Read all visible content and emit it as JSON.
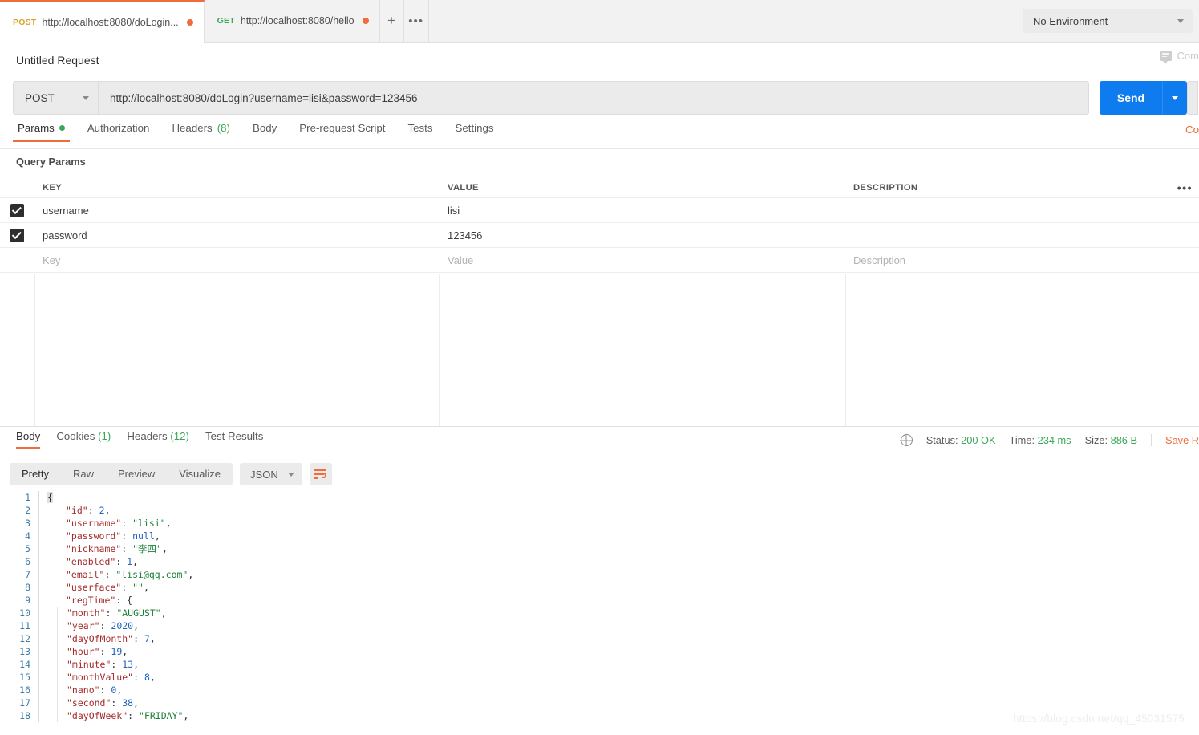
{
  "tabbar": {
    "tabs": [
      {
        "method": "POST",
        "url": "http://localhost:8080/doLogin...",
        "unsaved": true,
        "active": true
      },
      {
        "method": "GET",
        "url": "http://localhost:8080/hello",
        "unsaved": true,
        "active": false
      }
    ],
    "new_tab_label": "+",
    "more_label": "•••",
    "environment": {
      "value": "No Environment"
    }
  },
  "header": {
    "request_title": "Untitled Request",
    "comments_label": "Com"
  },
  "urlbar": {
    "method": "POST",
    "url": "http://localhost:8080/doLogin?username=lisi&password=123456",
    "send_label": "Send"
  },
  "request_tabs": {
    "items": [
      {
        "label": "Params",
        "dot": true,
        "count": "",
        "active": true
      },
      {
        "label": "Authorization",
        "dot": false,
        "count": "",
        "active": false
      },
      {
        "label": "Headers",
        "dot": false,
        "count": "(8)",
        "active": false
      },
      {
        "label": "Body",
        "dot": false,
        "count": "",
        "active": false
      },
      {
        "label": "Pre-request Script",
        "dot": false,
        "count": "",
        "active": false
      },
      {
        "label": "Tests",
        "dot": false,
        "count": "",
        "active": false
      },
      {
        "label": "Settings",
        "dot": false,
        "count": "",
        "active": false
      }
    ],
    "cookies_link": "Co"
  },
  "query_params": {
    "section_label": "Query Params",
    "columns": {
      "key": "KEY",
      "value": "VALUE",
      "description": "DESCRIPTION"
    },
    "rows": [
      {
        "checked": true,
        "key": "username",
        "value": "lisi",
        "description": "",
        "placeholder": false
      },
      {
        "checked": true,
        "key": "password",
        "value": "123456",
        "description": "",
        "placeholder": false
      }
    ],
    "placeholder_row": {
      "key": "Key",
      "value": "Value",
      "description": "Description"
    },
    "bulk_edit_label": "•••"
  },
  "response": {
    "tabs": [
      {
        "label": "Body",
        "count": "",
        "active": true
      },
      {
        "label": "Cookies",
        "count": "(1)",
        "active": false
      },
      {
        "label": "Headers",
        "count": "(12)",
        "active": false
      },
      {
        "label": "Test Results",
        "count": "",
        "active": false
      }
    ],
    "meta": {
      "status_label": "Status:",
      "status_value": "200 OK",
      "time_label": "Time:",
      "time_value": "234 ms",
      "size_label": "Size:",
      "size_value": "886 B",
      "save_response": "Save R"
    },
    "toolbar": {
      "views": [
        {
          "label": "Pretty",
          "active": true
        },
        {
          "label": "Raw",
          "active": false
        },
        {
          "label": "Preview",
          "active": false
        },
        {
          "label": "Visualize",
          "active": false
        }
      ],
      "format": "JSON"
    },
    "body_lines": [
      {
        "n": "1",
        "indent": 0,
        "tokens": [
          {
            "t": "p",
            "v": "{"
          }
        ]
      },
      {
        "n": "2",
        "indent": 1,
        "tokens": [
          {
            "t": "k",
            "v": "\"id\""
          },
          {
            "t": "p",
            "v": ": "
          },
          {
            "t": "n",
            "v": "2"
          },
          {
            "t": "p",
            "v": ","
          }
        ]
      },
      {
        "n": "3",
        "indent": 1,
        "tokens": [
          {
            "t": "k",
            "v": "\"username\""
          },
          {
            "t": "p",
            "v": ": "
          },
          {
            "t": "s",
            "v": "\"lisi\""
          },
          {
            "t": "p",
            "v": ","
          }
        ]
      },
      {
        "n": "4",
        "indent": 1,
        "tokens": [
          {
            "t": "k",
            "v": "\"password\""
          },
          {
            "t": "p",
            "v": ": "
          },
          {
            "t": "n",
            "v": "null"
          },
          {
            "t": "p",
            "v": ","
          }
        ]
      },
      {
        "n": "5",
        "indent": 1,
        "tokens": [
          {
            "t": "k",
            "v": "\"nickname\""
          },
          {
            "t": "p",
            "v": ": "
          },
          {
            "t": "s",
            "v": "\"李四\""
          },
          {
            "t": "p",
            "v": ","
          }
        ]
      },
      {
        "n": "6",
        "indent": 1,
        "tokens": [
          {
            "t": "k",
            "v": "\"enabled\""
          },
          {
            "t": "p",
            "v": ": "
          },
          {
            "t": "n",
            "v": "1"
          },
          {
            "t": "p",
            "v": ","
          }
        ]
      },
      {
        "n": "7",
        "indent": 1,
        "tokens": [
          {
            "t": "k",
            "v": "\"email\""
          },
          {
            "t": "p",
            "v": ": "
          },
          {
            "t": "s",
            "v": "\"lisi@qq.com\""
          },
          {
            "t": "p",
            "v": ","
          }
        ]
      },
      {
        "n": "8",
        "indent": 1,
        "tokens": [
          {
            "t": "k",
            "v": "\"userface\""
          },
          {
            "t": "p",
            "v": ": "
          },
          {
            "t": "s",
            "v": "\"\""
          },
          {
            "t": "p",
            "v": ","
          }
        ]
      },
      {
        "n": "9",
        "indent": 1,
        "tokens": [
          {
            "t": "k",
            "v": "\"regTime\""
          },
          {
            "t": "p",
            "v": ": {"
          }
        ]
      },
      {
        "n": "10",
        "indent": 2,
        "tokens": [
          {
            "t": "k",
            "v": "\"month\""
          },
          {
            "t": "p",
            "v": ": "
          },
          {
            "t": "s",
            "v": "\"AUGUST\""
          },
          {
            "t": "p",
            "v": ","
          }
        ]
      },
      {
        "n": "11",
        "indent": 2,
        "tokens": [
          {
            "t": "k",
            "v": "\"year\""
          },
          {
            "t": "p",
            "v": ": "
          },
          {
            "t": "n",
            "v": "2020"
          },
          {
            "t": "p",
            "v": ","
          }
        ]
      },
      {
        "n": "12",
        "indent": 2,
        "tokens": [
          {
            "t": "k",
            "v": "\"dayOfMonth\""
          },
          {
            "t": "p",
            "v": ": "
          },
          {
            "t": "n",
            "v": "7"
          },
          {
            "t": "p",
            "v": ","
          }
        ]
      },
      {
        "n": "13",
        "indent": 2,
        "tokens": [
          {
            "t": "k",
            "v": "\"hour\""
          },
          {
            "t": "p",
            "v": ": "
          },
          {
            "t": "n",
            "v": "19"
          },
          {
            "t": "p",
            "v": ","
          }
        ]
      },
      {
        "n": "14",
        "indent": 2,
        "tokens": [
          {
            "t": "k",
            "v": "\"minute\""
          },
          {
            "t": "p",
            "v": ": "
          },
          {
            "t": "n",
            "v": "13"
          },
          {
            "t": "p",
            "v": ","
          }
        ]
      },
      {
        "n": "15",
        "indent": 2,
        "tokens": [
          {
            "t": "k",
            "v": "\"monthValue\""
          },
          {
            "t": "p",
            "v": ": "
          },
          {
            "t": "n",
            "v": "8"
          },
          {
            "t": "p",
            "v": ","
          }
        ]
      },
      {
        "n": "16",
        "indent": 2,
        "tokens": [
          {
            "t": "k",
            "v": "\"nano\""
          },
          {
            "t": "p",
            "v": ": "
          },
          {
            "t": "n",
            "v": "0"
          },
          {
            "t": "p",
            "v": ","
          }
        ]
      },
      {
        "n": "17",
        "indent": 2,
        "tokens": [
          {
            "t": "k",
            "v": "\"second\""
          },
          {
            "t": "p",
            "v": ": "
          },
          {
            "t": "n",
            "v": "38"
          },
          {
            "t": "p",
            "v": ","
          }
        ]
      },
      {
        "n": "18",
        "indent": 2,
        "tokens": [
          {
            "t": "k",
            "v": "\"dayOfWeek\""
          },
          {
            "t": "p",
            "v": ": "
          },
          {
            "t": "s",
            "v": "\"FRIDAY\""
          },
          {
            "t": "p",
            "v": ","
          }
        ]
      }
    ]
  },
  "watermark": "https://blog.csdn.net/qq_45031575",
  "colors": {
    "accent_orange": "#f26b3a",
    "send_blue": "#0e7bef",
    "success_green": "#3aa757",
    "post_yellow": "#d9a326"
  }
}
